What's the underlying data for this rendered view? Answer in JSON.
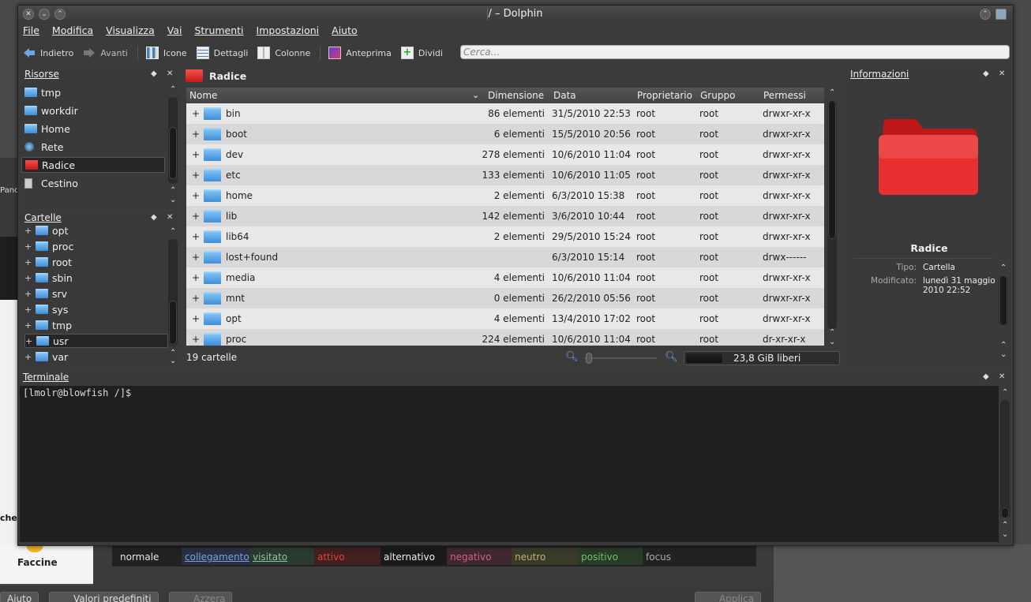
{
  "window": {
    "title": "/ – Dolphin"
  },
  "menu": [
    "File",
    "Modifica",
    "Visualizza",
    "Vai",
    "Strumenti",
    "Impostazioni",
    "Aiuto"
  ],
  "toolbar": {
    "back": "Indietro",
    "forward": "Avanti",
    "icons": "Icone",
    "details": "Dettagli",
    "columns": "Colonne",
    "preview": "Anteprima",
    "split": "Dividi",
    "search_placeholder": "Cerca..."
  },
  "places": {
    "title": "Risorse",
    "items": [
      {
        "label": "tmp",
        "icon": "folder-icon"
      },
      {
        "label": "workdir",
        "icon": "folder-icon"
      },
      {
        "label": "Home",
        "icon": "home-icon"
      },
      {
        "label": "Rete",
        "icon": "network-icon"
      },
      {
        "label": "Radice",
        "icon": "red-folder-icon",
        "selected": true
      },
      {
        "label": "Cestino",
        "icon": "trash-icon"
      }
    ]
  },
  "folders": {
    "title": "Cartelle",
    "items": [
      "opt",
      "proc",
      "root",
      "sbin",
      "srv",
      "sys",
      "tmp",
      "usr",
      "var"
    ],
    "selected": "usr"
  },
  "location": "Radice",
  "table": {
    "headers": [
      "Nome",
      "Dimensione",
      "Data",
      "Proprietario",
      "Gruppo",
      "Permessi"
    ],
    "rows": [
      {
        "name": "bin",
        "size": "86 elementi",
        "date": "31/5/2010 22:53",
        "owner": "root",
        "group": "root",
        "perm": "drwxr-xr-x"
      },
      {
        "name": "boot",
        "size": "6 elementi",
        "date": "15/5/2010 20:56",
        "owner": "root",
        "group": "root",
        "perm": "drwxr-xr-x"
      },
      {
        "name": "dev",
        "size": "278 elementi",
        "date": "10/6/2010 11:04",
        "owner": "root",
        "group": "root",
        "perm": "drwxr-xr-x"
      },
      {
        "name": "etc",
        "size": "133 elementi",
        "date": "10/6/2010 11:05",
        "owner": "root",
        "group": "root",
        "perm": "drwxr-xr-x"
      },
      {
        "name": "home",
        "size": "2 elementi",
        "date": "6/3/2010 15:38",
        "owner": "root",
        "group": "root",
        "perm": "drwxr-xr-x"
      },
      {
        "name": "lib",
        "size": "142 elementi",
        "date": "3/6/2010 10:44",
        "owner": "root",
        "group": "root",
        "perm": "drwxr-xr-x"
      },
      {
        "name": "lib64",
        "size": "2 elementi",
        "date": "29/5/2010 15:24",
        "owner": "root",
        "group": "root",
        "perm": "drwxr-xr-x"
      },
      {
        "name": "lost+found",
        "size": "",
        "date": "6/3/2010 15:14",
        "owner": "root",
        "group": "root",
        "perm": "drwx------"
      },
      {
        "name": "media",
        "size": "4 elementi",
        "date": "10/6/2010 11:04",
        "owner": "root",
        "group": "root",
        "perm": "drwxr-xr-x"
      },
      {
        "name": "mnt",
        "size": "0 elementi",
        "date": "26/2/2010 05:56",
        "owner": "root",
        "group": "root",
        "perm": "drwxr-xr-x"
      },
      {
        "name": "opt",
        "size": "4 elementi",
        "date": "13/4/2010 17:02",
        "owner": "root",
        "group": "root",
        "perm": "drwxr-xr-x"
      },
      {
        "name": "proc",
        "size": "224 elementi",
        "date": "10/6/2010 11:04",
        "owner": "root",
        "group": "root",
        "perm": "dr-xr-xr-x"
      }
    ]
  },
  "status": {
    "count": "19 cartelle",
    "free": "23,8 GiB liberi"
  },
  "info": {
    "title": "Informazioni",
    "name": "Radice",
    "type_label": "Tipo:",
    "type_value": "Cartella",
    "modified_label": "Modificato:",
    "modified_value_1": "lunedì 31 maggio",
    "modified_value_2": "2010 22:52"
  },
  "terminal": {
    "title": "Terminale",
    "prompt": "[lmolr@blowfish /]$"
  },
  "background": {
    "pan": "Panc",
    "cher": "cher",
    "faccine": "Faccine",
    "color_labels": [
      "normale",
      "collegamento",
      "visitato",
      "attivo",
      "alternativo",
      "negativo",
      "neutro",
      "positivo",
      "focus"
    ],
    "buttons": [
      "Aiuto",
      "Valori predefiniti",
      "Azzera",
      "Applica"
    ]
  }
}
